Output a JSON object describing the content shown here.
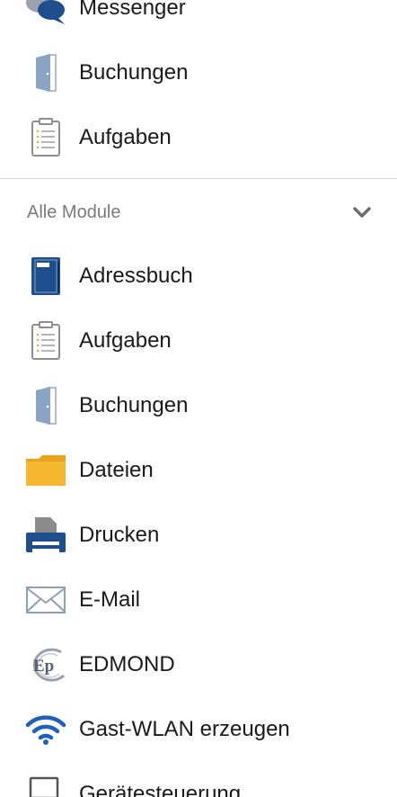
{
  "top_items": [
    {
      "label": "Messenger",
      "icon": "chat-bubbles-icon"
    },
    {
      "label": "Buchungen",
      "icon": "door-icon"
    },
    {
      "label": "Aufgaben",
      "icon": "clipboard-icon"
    }
  ],
  "modules_section": {
    "title": "Alle Module",
    "toggle_icon": "chevron-down-icon"
  },
  "modules": [
    {
      "label": "Adressbuch",
      "icon": "address-book-icon"
    },
    {
      "label": "Aufgaben",
      "icon": "clipboard-icon"
    },
    {
      "label": "Buchungen",
      "icon": "door-icon"
    },
    {
      "label": "Dateien",
      "icon": "folder-icon"
    },
    {
      "label": "Drucken",
      "icon": "printer-icon"
    },
    {
      "label": "E-Mail",
      "icon": "envelope-icon"
    },
    {
      "label": "EDMOND",
      "icon": "edmond-logo-icon"
    },
    {
      "label": "Gast-WLAN erzeugen",
      "icon": "wifi-icon"
    },
    {
      "label": "Gerätesteuerung",
      "icon": "laptop-icon"
    }
  ],
  "colors": {
    "brand_blue": "#1f4e8c",
    "door_blue": "#8aa4c4",
    "folder_yellow": "#f5b82e",
    "divider": "#d9d9d9",
    "muted_text": "#7a7a7a"
  }
}
